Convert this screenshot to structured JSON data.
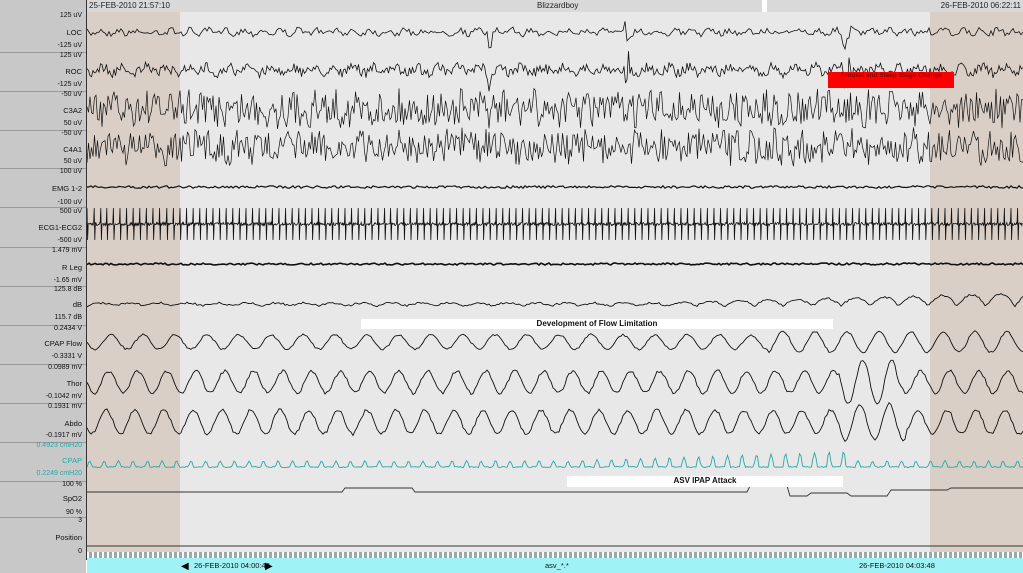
{
  "header": {
    "start_time": "25-FEB-2010 21:57:10",
    "patient": "Blizzardboy",
    "end_time": "26-FEB-2010 06:22:11"
  },
  "channels": [
    {
      "name": "LOC",
      "top": "125 uV",
      "bottom": "-125 uV"
    },
    {
      "name": "ROC",
      "top": "125 uV",
      "bottom": "-125 uV"
    },
    {
      "name": "C3A2",
      "top": "-50 uV",
      "bottom": "50 uV"
    },
    {
      "name": "C4A1",
      "top": "-50 uV",
      "bottom": "50 uV"
    },
    {
      "name": "EMG 1-2",
      "top": "100 uV",
      "bottom": "-100 uV"
    },
    {
      "name": "ECG1-ECG2",
      "top": "500 uV",
      "bottom": "-500 uV"
    },
    {
      "name": "R Leg",
      "top": "1.479 mV",
      "bottom": "-1.65 mV"
    },
    {
      "name": "dB",
      "top": "125.8 dB",
      "bottom": "115.7 dB"
    },
    {
      "name": "CPAP Flow",
      "top": "0.2434 V",
      "bottom": "-0.3331 V"
    },
    {
      "name": "Thor",
      "top": "0.0989 mV",
      "bottom": "-0.1042 mV"
    },
    {
      "name": "Abdo",
      "top": "0.1931 mV",
      "bottom": "-0.1917 mV"
    },
    {
      "name": "CPAP",
      "top": "0.4923 cmH20",
      "bottom": "0.2249 cmH20"
    },
    {
      "name": "SpO2",
      "top": "100 %",
      "bottom": "90 %"
    },
    {
      "name": "Position",
      "top": "3",
      "bottom": "0"
    }
  ],
  "annotations": {
    "arousal": "Arousal and Sleep Stage Change",
    "flow_limitation": "Development of Flow Limitation",
    "ipap_attack": "ASV IPAP Attack"
  },
  "footer": {
    "page_start": "26-FEB-2010 04:00:48",
    "montage": "asv_*.*",
    "page_end": "26-FEB-2010 04:03:48"
  },
  "colors": {
    "trace": "#111111",
    "cpap_trace": "#2aa7a7",
    "background": "#e8e8e8",
    "shade": "#d9cfc7",
    "footer_bg": "#9ff3f6",
    "annotation_red": "#ff0000"
  }
}
